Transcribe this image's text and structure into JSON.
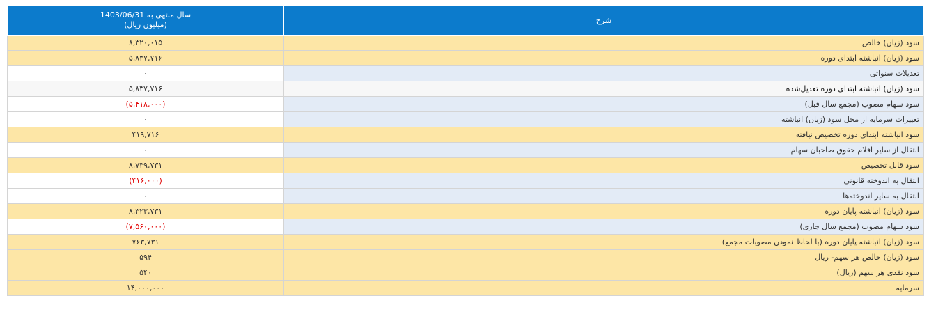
{
  "header": {
    "value_line1": "سال منتهی به 1403/06/31",
    "value_line2": "(میلیون ریال)",
    "description": "شرح"
  },
  "rows": [
    {
      "label": "سود (زیان) خالص",
      "value": "۸,۳۲۰,۰۱۵",
      "style": "yellow",
      "negative": false
    },
    {
      "label": "سود (زیان) انباشته ابتدای دوره",
      "value": "۵,۸۳۷,۷۱۶",
      "style": "yellow",
      "negative": false
    },
    {
      "label": "تعدیلات سنواتی",
      "value": "۰",
      "style": "white",
      "negative": false
    },
    {
      "label": "سود (زیان) انباشته ابتدای دوره تعدیل‌شده",
      "value": "۵,۸۳۷,۷۱۶",
      "style": "plain",
      "negative": false
    },
    {
      "label": "سود سهام مصوب (مجمع سال قبل)",
      "value": "(۵,۴۱۸,۰۰۰)",
      "style": "white",
      "negative": true
    },
    {
      "label": "تغییرات سرمایه از محل سود (زیان) انباشته",
      "value": "۰",
      "style": "white",
      "negative": false
    },
    {
      "label": "سود انباشته ابتدای دوره تخصیص نیافته",
      "value": "۴۱۹,۷۱۶",
      "style": "yellow",
      "negative": false
    },
    {
      "label": "انتقال از سایر اقلام حقوق صاحبان سهام",
      "value": "۰",
      "style": "white",
      "negative": false
    },
    {
      "label": "سود قابل تخصیص",
      "value": "۸,۷۳۹,۷۳۱",
      "style": "yellow",
      "negative": false
    },
    {
      "label": "انتقال به اندوخته قانونی",
      "value": "(۴۱۶,۰۰۰)",
      "style": "white",
      "negative": true
    },
    {
      "label": "انتقال به سایر اندوخته‌ها",
      "value": "۰",
      "style": "white",
      "negative": false
    },
    {
      "label": "سود (زیان) انباشته پایان دوره",
      "value": "۸,۳۲۳,۷۳۱",
      "style": "yellow",
      "negative": false
    },
    {
      "label": "سود سهام مصوب (مجمع سال جاری)",
      "value": "(۷,۵۶۰,۰۰۰)",
      "style": "white",
      "negative": true
    },
    {
      "label": "سود (زیان) انباشته پایان دوره (با لحاظ نمودن مصوبات مجمع)",
      "value": "۷۶۳,۷۳۱",
      "style": "yellow",
      "negative": false
    },
    {
      "label": "سود (زیان) خالص هر سهم- ریال",
      "value": "۵۹۴",
      "style": "yellow",
      "negative": false
    },
    {
      "label": "سود نقدی هر سهم (ریال)",
      "value": "۵۴۰",
      "style": "yellow",
      "negative": false
    },
    {
      "label": "سرمایه",
      "value": "۱۴,۰۰۰,۰۰۰",
      "style": "yellow",
      "negative": false
    }
  ]
}
